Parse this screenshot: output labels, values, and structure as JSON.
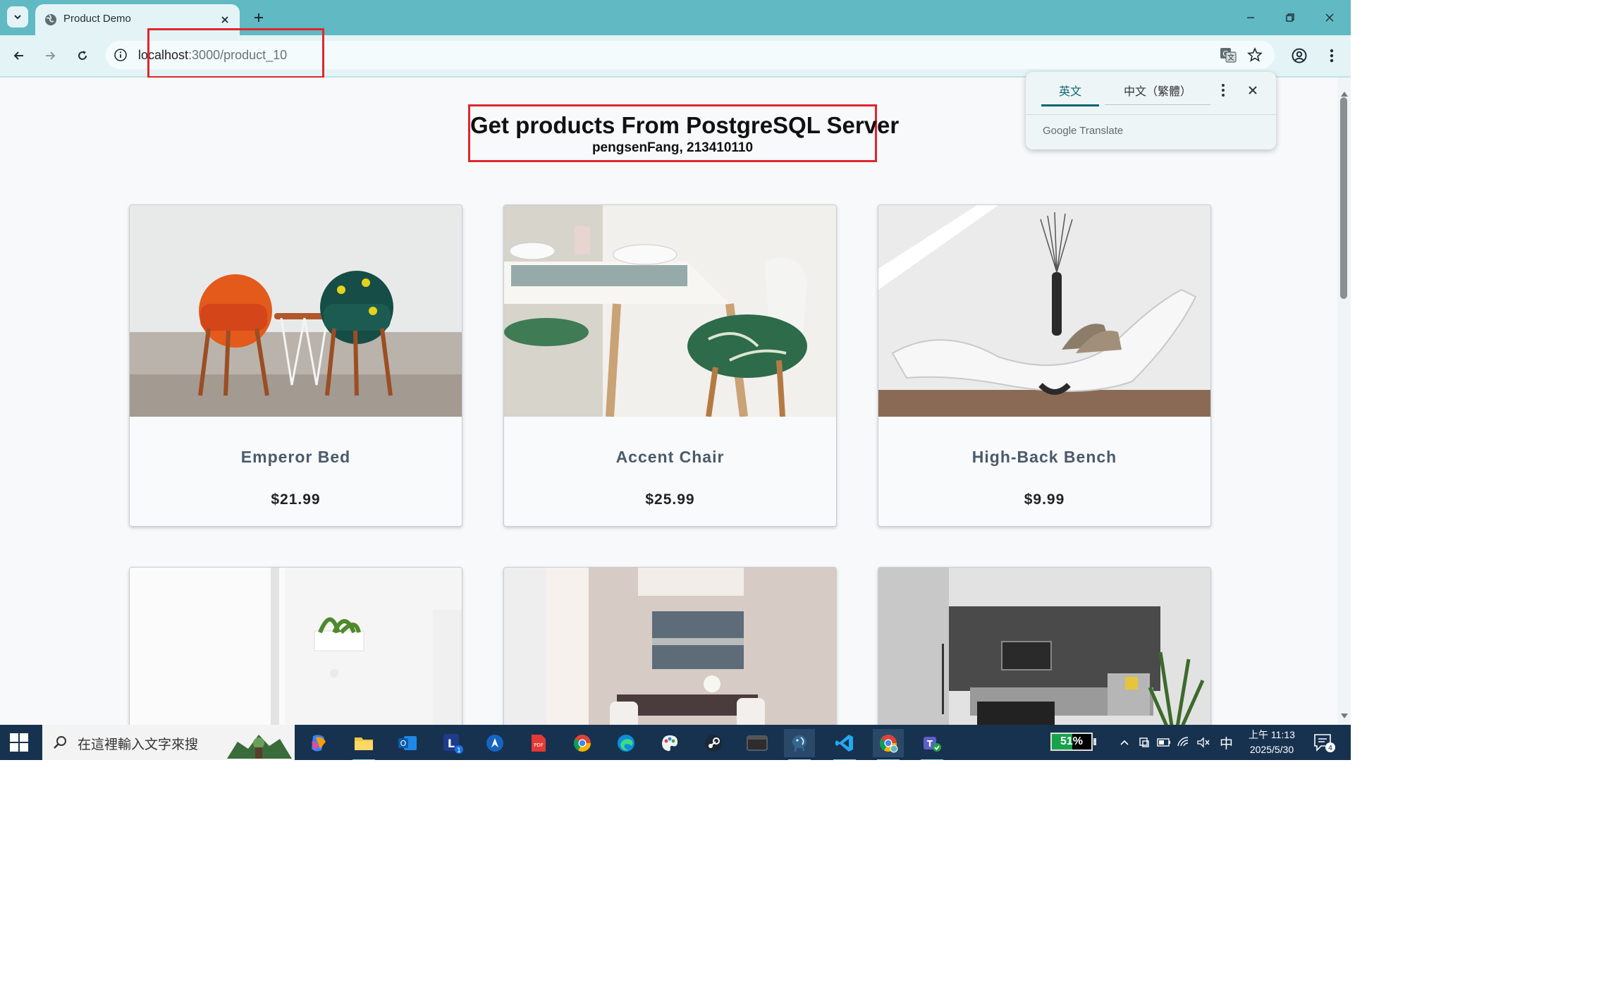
{
  "browser": {
    "tab_title": "Product Demo",
    "url_host": "localhost",
    "url_rest": ":3000/product_10"
  },
  "translate_popup": {
    "source_lang": "英文",
    "target_lang": "中文（繁體）",
    "brand": "Google Translate"
  },
  "page": {
    "title": "Get products From PostgreSQL Server",
    "subtitle": "pengsenFang, 213410110",
    "products": [
      {
        "name": "Emperor Bed",
        "price": "$21.99"
      },
      {
        "name": "Accent Chair",
        "price": "$25.99"
      },
      {
        "name": "High-Back Bench",
        "price": "$9.99"
      },
      {
        "name": "",
        "price": ""
      },
      {
        "name": "",
        "price": ""
      },
      {
        "name": "",
        "price": ""
      }
    ]
  },
  "taskbar": {
    "search_placeholder": "在這裡輸入文字來搜",
    "battery_percent": "51%",
    "battery_level": 0.51,
    "ime": "中",
    "time": "上午 11:13",
    "date": "2025/5/30",
    "notification_count": "4",
    "outlook_badge": "1",
    "apps": [
      "copilot-icon",
      "file-explorer-icon",
      "outlook-icon",
      "line-icon",
      "arrow-app-icon",
      "pdf-icon",
      "chrome-icon",
      "edge-icon",
      "paint-icon",
      "steam-icon",
      "terminal-icon",
      "postgresql-icon",
      "vscode-icon",
      "chrome-profile-icon",
      "teams-icon"
    ]
  },
  "colors": {
    "tab_strip": "#60b9c3",
    "toolbar": "#e4f4f6",
    "annotation_red": "#e0262c",
    "taskbar": "#17324f"
  }
}
